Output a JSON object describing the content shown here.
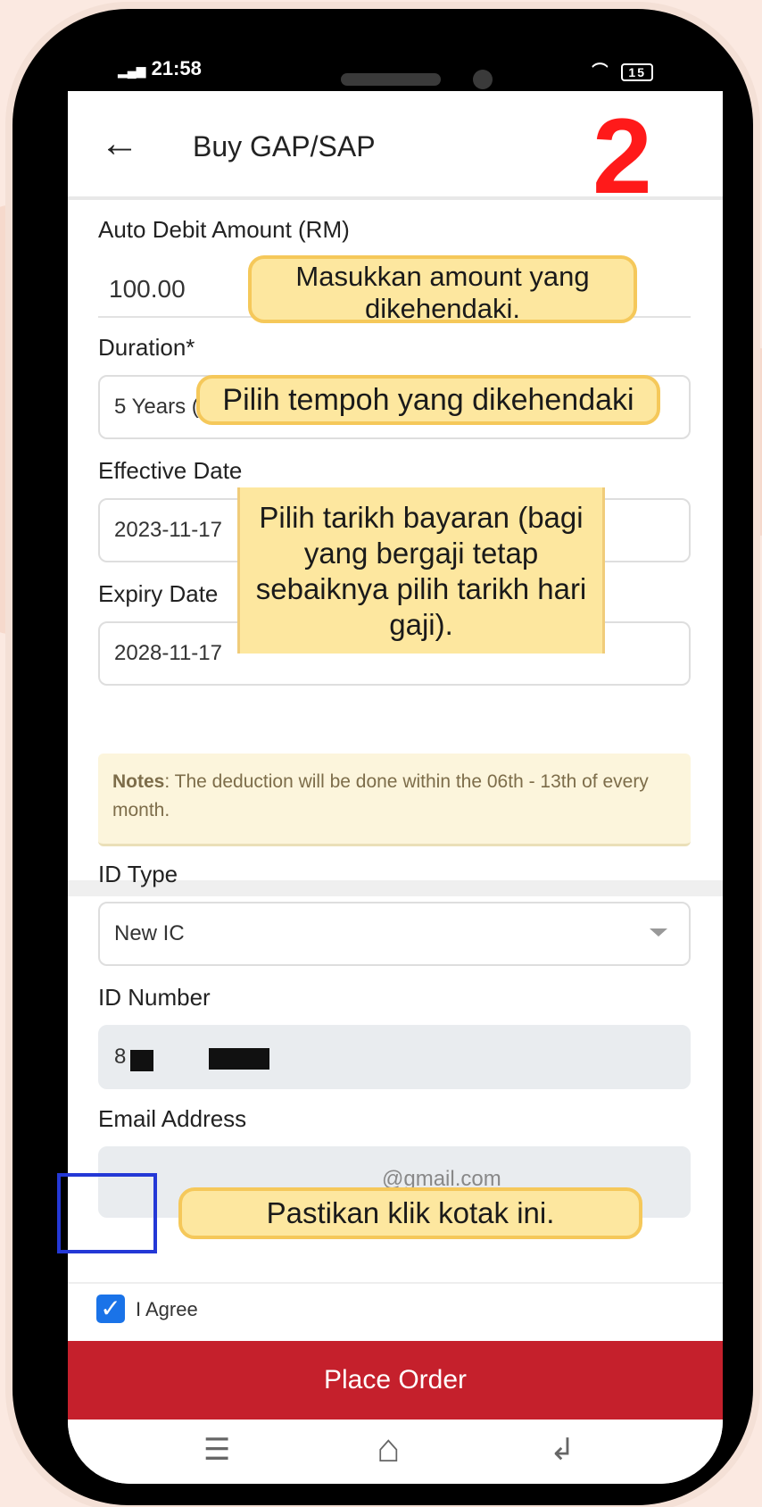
{
  "status_bar": {
    "time": "21:58",
    "signal": "•••▎",
    "network": "◢ ◔",
    "battery": "15"
  },
  "header": {
    "title": "Buy GAP/SAP",
    "back_icon": "arrow-left",
    "step_number": "2"
  },
  "form": {
    "auto_debit": {
      "label": "Auto Debit Amount (RM)",
      "value": "100.00"
    },
    "duration": {
      "label": "Duration*",
      "value": "5 Years ("
    },
    "effective_date": {
      "label": "Effective Date",
      "value": "2023-11-17"
    },
    "expiry_date": {
      "label": "Expiry Date",
      "value": "2028-11-17"
    },
    "notes": {
      "prefix": "Notes",
      "text": ": The deduction will be done within the 06th - 13th of every month."
    },
    "id_type": {
      "label": "ID Type",
      "value": "New IC"
    },
    "id_number": {
      "label": "ID Number",
      "value": "8"
    },
    "email": {
      "label": "Email Address",
      "value": "@gmail.com"
    }
  },
  "agreement": {
    "label": "I Agree",
    "checked": true
  },
  "place_order": {
    "label": "Place Order"
  },
  "nav": {
    "menu": "☰",
    "home": "⌂",
    "back": "↲"
  },
  "callouts": {
    "amount": "Masukkan amount yang dikehendaki.",
    "duration": "Pilih tempoh yang dikehendaki",
    "date": "Pilih tarikh bayaran (bagi yang bergaji tetap sebaiknya pilih tarikh hari gaji).",
    "checkbox": "Pastikan klik kotak ini."
  },
  "colors": {
    "accent_red": "#c5202c",
    "step_red": "#ff1a1a",
    "callout_yellow": "#fde79f",
    "highlight_blue": "#2438d6",
    "checkbox_blue": "#1a73e8"
  }
}
